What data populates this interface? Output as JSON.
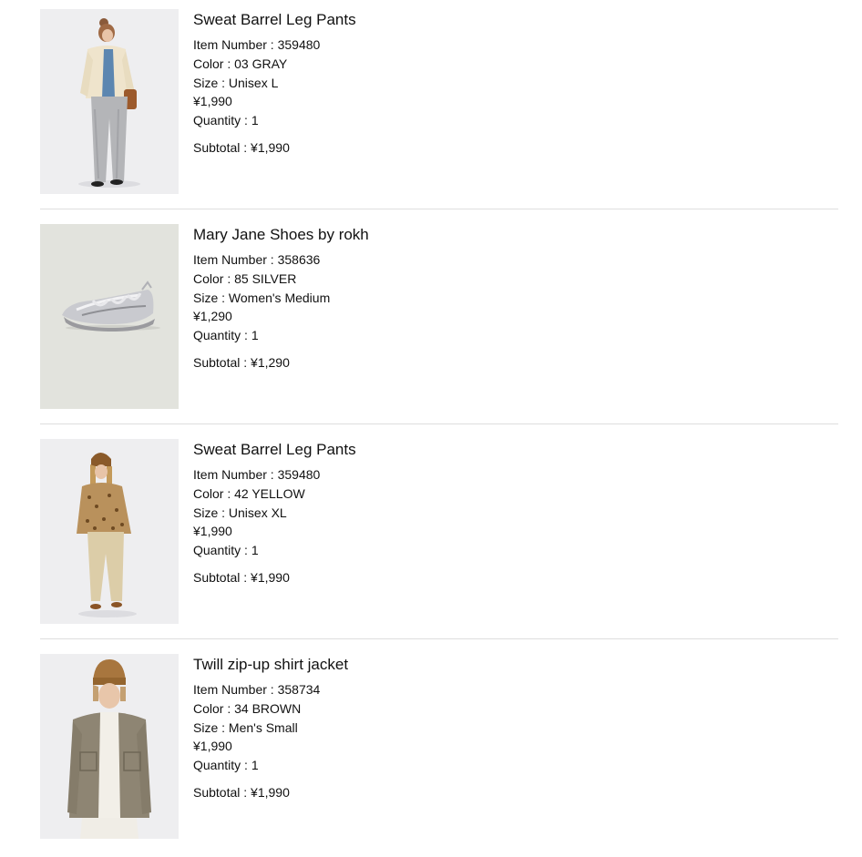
{
  "labels": {
    "item_number": "Item Number : ",
    "color": "Color : ",
    "size": "Size : ",
    "quantity": "Quantity : ",
    "subtotal": "Subtotal : "
  },
  "items": [
    {
      "name": "Sweat Barrel Leg Pants",
      "item_number": "359480",
      "color": "03 GRAY",
      "size": "Unisex L",
      "price": "¥1,990",
      "quantity": "1",
      "subtotal": "¥1,990",
      "image_bg": "#eeeef0"
    },
    {
      "name": "Mary Jane Shoes by rokh",
      "item_number": "358636",
      "color": "85 SILVER",
      "size": "Women's Medium",
      "price": "¥1,290",
      "quantity": "1",
      "subtotal": "¥1,290",
      "image_bg": "#e2e3dd"
    },
    {
      "name": "Sweat Barrel Leg Pants",
      "item_number": "359480",
      "color": "42 YELLOW",
      "size": "Unisex XL",
      "price": "¥1,990",
      "quantity": "1",
      "subtotal": "¥1,990",
      "image_bg": "#eeeef0"
    },
    {
      "name": "Twill zip-up shirt jacket",
      "item_number": "358734",
      "color": "34 BROWN",
      "size": "Men's Small",
      "price": "¥1,990",
      "quantity": "1",
      "subtotal": "¥1,990",
      "image_bg": "#eeeef0"
    }
  ]
}
